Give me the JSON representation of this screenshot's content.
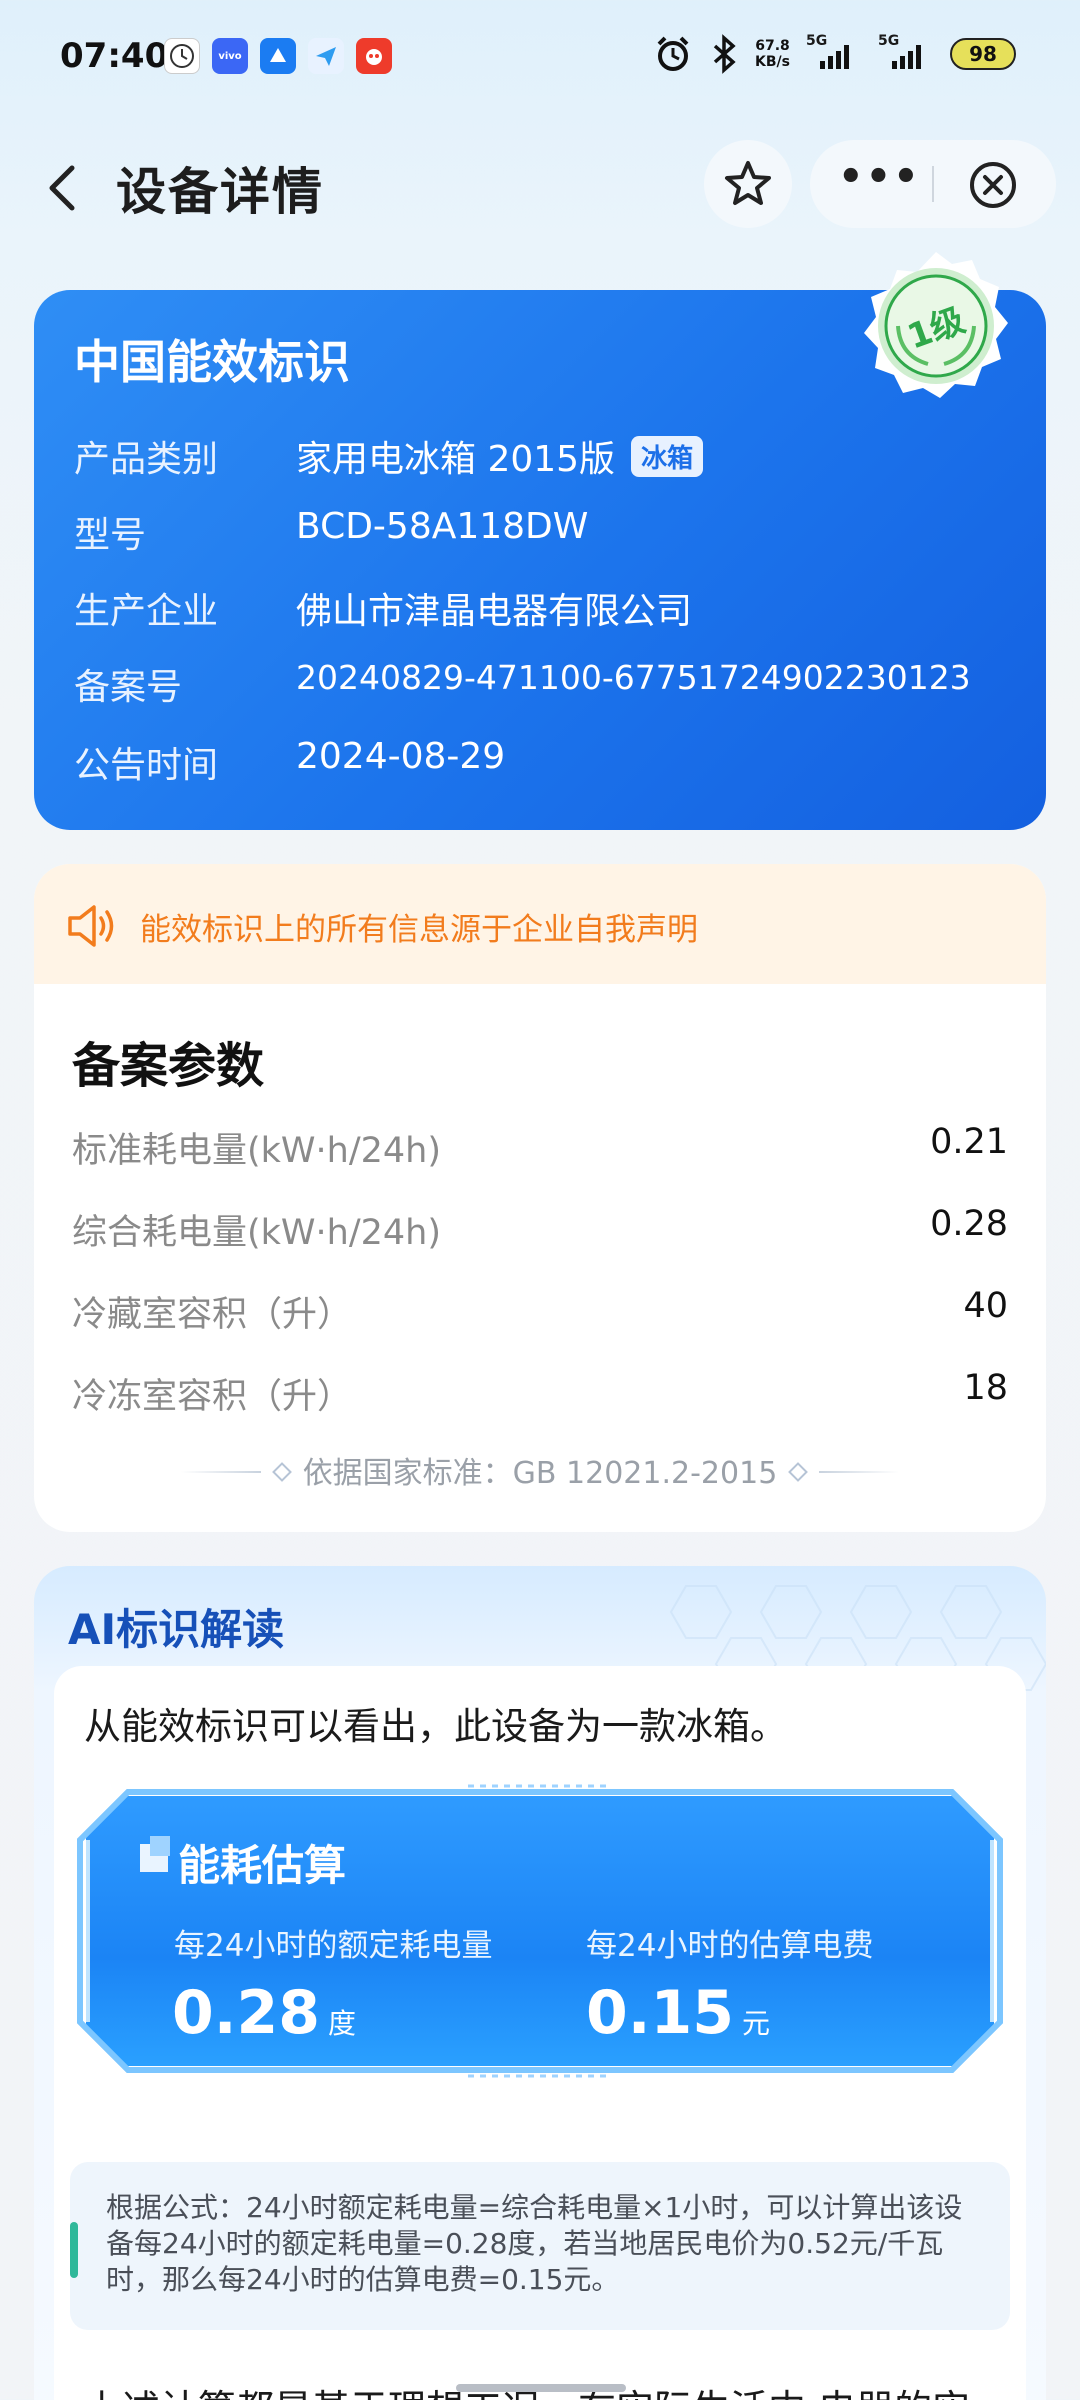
{
  "status_bar": {
    "time": "07:40",
    "apps": [
      {
        "icon": "clock-app-icon",
        "color": "#ffffff"
      },
      {
        "icon": "vivo-app-icon",
        "label": "vivo",
        "color": "#3b67f5"
      },
      {
        "icon": "browser-app-icon",
        "color": "#1b7cf2"
      },
      {
        "icon": "send-app-icon",
        "color": "#2e9cf0"
      },
      {
        "icon": "taobao-app-icon",
        "color": "#ee3b2b"
      }
    ],
    "net_speed": "67.8",
    "net_unit": "KB/s",
    "sim1": "5G",
    "sim2": "5G",
    "battery": "98"
  },
  "nav": {
    "title": "设备详情"
  },
  "label": {
    "title": "中国能效标识",
    "grade": "1级",
    "rows": [
      {
        "key": "产品类别",
        "value": "家用电冰箱 2015版",
        "tag": "冰箱"
      },
      {
        "key": "型号",
        "value": "BCD-58A118DW"
      },
      {
        "key": "生产企业",
        "value": "佛山市津晶电器有限公司"
      },
      {
        "key": "备案号",
        "value": "20240829-471100-67751724902230123"
      },
      {
        "key": "公告时间",
        "value": "2024-08-29"
      }
    ]
  },
  "notice": {
    "text": "能效标识上的所有信息源于企业自我声明"
  },
  "params": {
    "title": "备案参数",
    "rows": [
      {
        "label": "标准耗电量(kW·h/24h)",
        "value": "0.21"
      },
      {
        "label": "综合耗电量(kW·h/24h)",
        "value": "0.28"
      },
      {
        "label": "冷藏室容积（升）",
        "value": "40"
      },
      {
        "label": "冷冻室容积（升）",
        "value": "18"
      }
    ],
    "standard": "依据国家标准：GB 12021.2-2015"
  },
  "ai": {
    "title": "AI标识解读",
    "intro": "从能效标识可以看出，此设备为一款冰箱。",
    "estimate": {
      "title": "能耗估算",
      "left_label": "每24小时的额定耗电量",
      "left_value": "0.28",
      "left_unit": "度",
      "right_label": "每24小时的估算电费",
      "right_value": "0.15",
      "right_unit": "元"
    },
    "formula": "根据公式：24小时额定耗电量=综合耗电量×1小时，可以计算出该设备每24小时的额定耗电量=0.28度，若当地居民电价为0.52元/千瓦时，那么每24小时的估算电费=0.15元。",
    "bottom": "上述计算都是基于理想工况，在实际生活中,电器的实"
  },
  "colors": {
    "primary_blue": "#1c74ec",
    "notice_orange": "#f27c1d",
    "seal_green": "#2fa84a"
  }
}
